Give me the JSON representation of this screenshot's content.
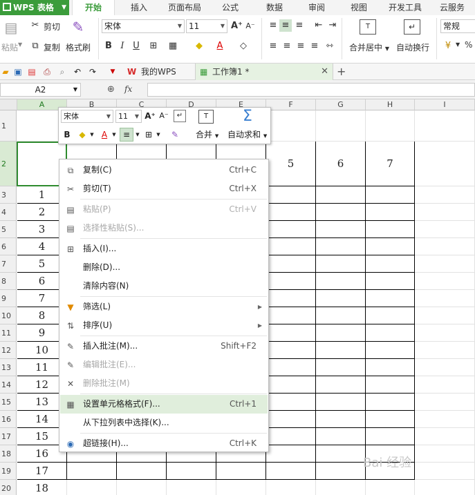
{
  "app": {
    "name": "WPS 表格"
  },
  "ribbon_tabs": [
    {
      "label": "开始",
      "active": true
    },
    {
      "label": "插入"
    },
    {
      "label": "页面布局"
    },
    {
      "label": "公式"
    },
    {
      "label": "数据"
    },
    {
      "label": "审阅"
    },
    {
      "label": "视图"
    },
    {
      "label": "开发工具"
    },
    {
      "label": "云服务"
    }
  ],
  "ribbon": {
    "paste": "粘贴",
    "cut": "剪切",
    "copy": "复制",
    "format_painter": "格式刷",
    "font_name": "宋体",
    "font_size": "11",
    "merge_center": "合并居中",
    "wrap_text": "自动换行",
    "number_format": "常规",
    "percent_symbol": "%"
  },
  "quick_access": {
    "tabs": [
      {
        "label": "我的WPS"
      },
      {
        "label": "工作簿1 *"
      }
    ]
  },
  "formula_bar": {
    "name_box": "A2",
    "fx": "fx",
    "value": ""
  },
  "grid": {
    "columns": [
      "A",
      "B",
      "C",
      "D",
      "E",
      "F",
      "G",
      "H",
      "I"
    ],
    "rows": [
      "1",
      "2",
      "3",
      "4",
      "5",
      "6",
      "7",
      "8",
      "9",
      "10",
      "11",
      "12",
      "13",
      "14",
      "15",
      "16",
      "17",
      "18",
      "19",
      "20"
    ],
    "row2_visible": [
      "5",
      "6",
      "7"
    ],
    "col_a_values": [
      "1",
      "2",
      "3",
      "4",
      "5",
      "6",
      "7",
      "8",
      "9",
      "10",
      "11",
      "12",
      "13",
      "14",
      "15",
      "16",
      "17",
      "18"
    ]
  },
  "mini_toolbar": {
    "font_name": "宋体",
    "font_size": "11",
    "merge": "合并",
    "autosum": "自动求和"
  },
  "context_menu": {
    "items": [
      {
        "label": "复制(C)",
        "shortcut": "Ctrl+C",
        "icon": "copy-icon"
      },
      {
        "label": "剪切(T)",
        "shortcut": "Ctrl+X",
        "icon": "scissors-icon"
      },
      {
        "label": "粘贴(P)",
        "shortcut": "Ctrl+V",
        "icon": "paste-icon",
        "disabled": true
      },
      {
        "label": "选择性粘贴(S)...",
        "shortcut": "",
        "icon": "paste-special-icon",
        "disabled": true
      },
      {
        "label": "插入(I)...",
        "shortcut": "",
        "icon": "insert-icon"
      },
      {
        "label": "删除(D)...",
        "shortcut": "",
        "icon": ""
      },
      {
        "label": "清除内容(N)",
        "shortcut": "",
        "icon": ""
      },
      {
        "label": "筛选(L)",
        "shortcut": "",
        "icon": "filter-icon",
        "submenu": true
      },
      {
        "label": "排序(U)",
        "shortcut": "",
        "icon": "sort-icon",
        "submenu": true
      },
      {
        "label": "插入批注(M)...",
        "shortcut": "Shift+F2",
        "icon": "comment-icon"
      },
      {
        "label": "编辑批注(E)...",
        "shortcut": "",
        "icon": "edit-comment-icon",
        "disabled": true
      },
      {
        "label": "删除批注(M)",
        "shortcut": "",
        "icon": "delete-comment-icon",
        "disabled": true
      },
      {
        "label": "设置单元格格式(F)...",
        "shortcut": "Ctrl+1",
        "icon": "format-cells-icon",
        "highlighted": true
      },
      {
        "label": "从下拉列表中选择(K)...",
        "shortcut": "",
        "icon": ""
      },
      {
        "label": "超链接(H)...",
        "shortcut": "Ctrl+K",
        "icon": "hyperlink-icon"
      }
    ]
  },
  "watermark": "Bai 经验",
  "colors": {
    "accent": "#3b9c3b",
    "menu_highlight": "#e0eedc",
    "grid_line": "#e2e2e2"
  }
}
